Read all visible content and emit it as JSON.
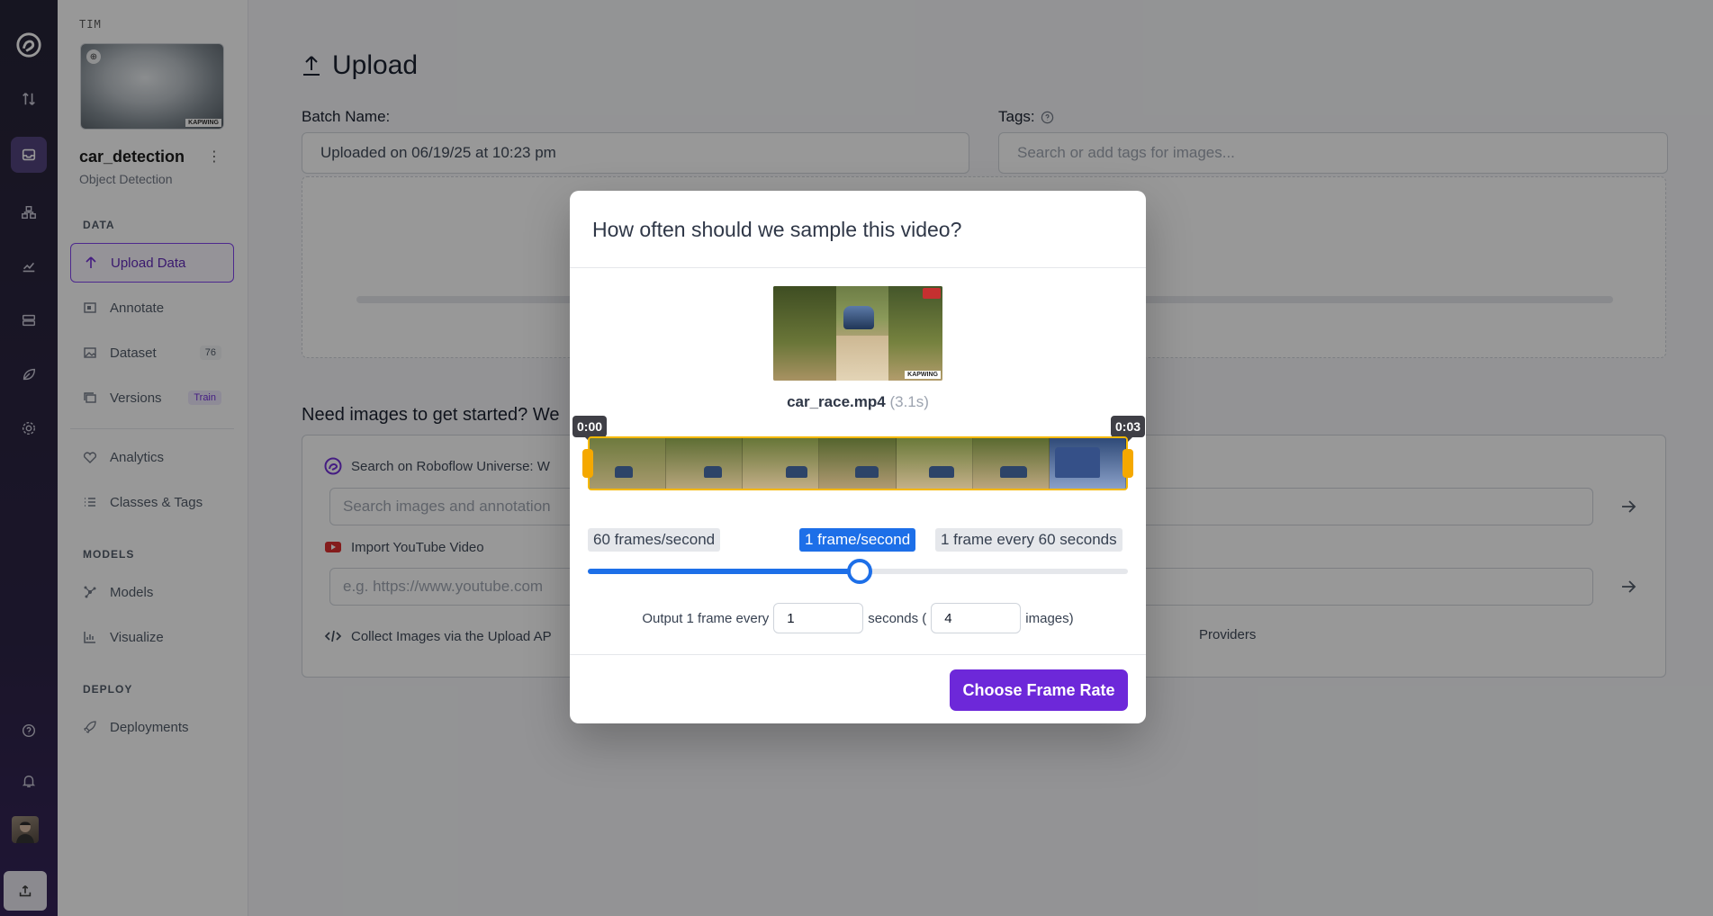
{
  "workspace": {
    "name": "TIM"
  },
  "project": {
    "name": "car_detection",
    "type": "Object Detection",
    "thumbnail_watermark": "KAPWING"
  },
  "sidebar": {
    "sections": {
      "data": "DATA",
      "models": "MODELS",
      "deploy": "DEPLOY"
    },
    "items": [
      {
        "label": "Upload Data",
        "icon": "upload-arrow-icon",
        "active": true
      },
      {
        "label": "Annotate",
        "icon": "annotate-icon"
      },
      {
        "label": "Dataset",
        "icon": "dataset-icon",
        "badge": "76"
      },
      {
        "label": "Versions",
        "icon": "versions-icon",
        "badge": "Train"
      },
      {
        "label": "Analytics",
        "icon": "analytics-icon"
      },
      {
        "label": "Classes & Tags",
        "icon": "list-icon"
      },
      {
        "label": "Models",
        "icon": "models-icon"
      },
      {
        "label": "Visualize",
        "icon": "visualize-icon"
      },
      {
        "label": "Deployments",
        "icon": "rocket-icon"
      }
    ]
  },
  "main": {
    "title": "Upload",
    "batch_label": "Batch Name:",
    "batch_value": "Uploaded on 06/19/25 at 10:23 pm",
    "tags_label": "Tags:",
    "tags_placeholder": "Search or add tags for images...",
    "need_images": "Need images to get started? We",
    "universe_label": "Search on Roboflow Universe: W",
    "universe_placeholder": "Search images and annotation",
    "youtube_label": "Import YouTube Video",
    "youtube_placeholder": "e.g. https://www.youtube.com",
    "api_label": "Collect Images via the Upload AP",
    "providers_label": "Providers"
  },
  "modal": {
    "title": "How often should we sample this video?",
    "preview_watermark": "KAPWING",
    "file_name": "car_race.mp4",
    "duration": "(3.1s)",
    "time_start": "0:00",
    "time_end": "0:03",
    "rate_left": "60 frames/second",
    "rate_current": "1 frame/second",
    "rate_right": "1 frame every 60 seconds",
    "slider_fraction": 0.503,
    "output_prefix": "Output 1 frame every",
    "seconds_value": "1",
    "output_mid": "seconds (",
    "images_value": "4",
    "output_suffix": "images)",
    "choose_button": "Choose Frame Rate"
  },
  "colors": {
    "accent": "#6d28d9",
    "slider": "#1d6fe8",
    "trim": "#f5b800"
  }
}
